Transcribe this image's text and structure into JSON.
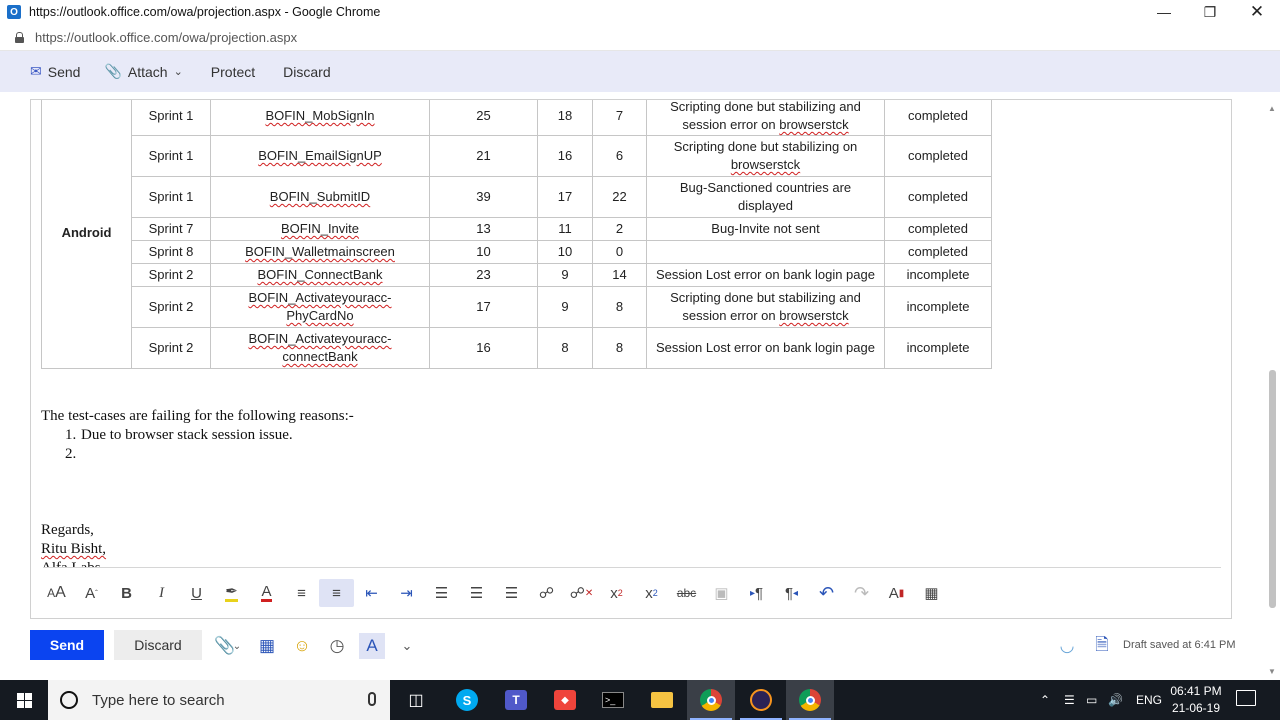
{
  "window": {
    "title": "https://outlook.office.com/owa/projection.aspx - Google Chrome",
    "icon": "outlook-icon",
    "controls": [
      "minimize-icon",
      "restore-icon",
      "close-icon"
    ]
  },
  "address": {
    "url": "https://outlook.office.com/owa/projection.aspx"
  },
  "command_bar": {
    "send_label": "Send",
    "attach_label": "Attach",
    "protect_label": "Protect",
    "discard_label": "Discard"
  },
  "table": {
    "group_label": "Android",
    "rows": [
      {
        "sprint": "Sprint 1",
        "name": "BOFIN_MobSignIn",
        "total": "25",
        "pass": "18",
        "fail": "7",
        "remarks": [
          "Scripting done but stabilizing and",
          "session error on ",
          "browserstck"
        ],
        "status": "completed"
      },
      {
        "sprint": "Sprint 1",
        "name": "BOFIN_EmailSignUP",
        "total": "21",
        "pass": "16",
        "fail": "6",
        "remarks": [
          "Scripting done but stabilizing on",
          "",
          "browserstck"
        ],
        "status": "completed"
      },
      {
        "sprint": "Sprint 1",
        "name": "BOFIN_SubmitID",
        "total": "39",
        "pass": "17",
        "fail": "22",
        "remarks": [
          "Bug-Sanctioned countries are",
          "displayed",
          ""
        ],
        "status": "completed"
      },
      {
        "sprint": "Sprint 7",
        "name": "BOFIN_Invite",
        "total": "13",
        "pass": "11",
        "fail": "2",
        "remarks": [
          "Bug-Invite not sent",
          "",
          ""
        ],
        "status": "completed"
      },
      {
        "sprint": "Sprint 8",
        "name": "BOFIN_Walletmainscreen",
        "total": "10",
        "pass": "10",
        "fail": "0",
        "remarks": [
          "",
          "",
          ""
        ],
        "status": "completed"
      },
      {
        "sprint": "Sprint 2",
        "name": "BOFIN_ConnectBank",
        "total": "23",
        "pass": "9",
        "fail": "14",
        "remarks": [
          "Session Lost error on bank login page",
          "",
          ""
        ],
        "status": "incomplete"
      },
      {
        "sprint": "Sprint 2",
        "name": "BOFIN_Activateyouracc-PhyCardNo",
        "total": "17",
        "pass": "9",
        "fail": "8",
        "remarks": [
          "Scripting done but stabilizing and",
          "session error on ",
          "browserstck"
        ],
        "status": "incomplete"
      },
      {
        "sprint": "Sprint 2",
        "name": "BOFIN_Activateyouracc-connectBank",
        "total": "16",
        "pass": "8",
        "fail": "8",
        "remarks": [
          "Session Lost error on bank login page",
          "",
          ""
        ],
        "status": "incomplete"
      }
    ],
    "name_line2": "connectBank",
    "name_line1": "BOFIN_Activateyouracc-"
  },
  "message": {
    "intro": "The test-cases are failing for the following reasons:-",
    "reason_1": "Due to browser stack session issue.",
    "reason_1_marker": "1.",
    "reason_2_marker": "2.",
    "closing": "Regards,",
    "signer": "Ritu Bisht,",
    "company": "Alfa Labs"
  },
  "format_toolbar": [
    "font-size-icon",
    "grow-font-icon",
    "bold-icon",
    "italic-icon",
    "underline-icon",
    "highlight-icon",
    "font-color-icon",
    "bullets-icon",
    "numbering-icon",
    "decrease-indent-icon",
    "increase-indent-icon",
    "align-left-icon",
    "align-center-icon",
    "align-right-icon",
    "insert-link-icon",
    "remove-link-icon",
    "superscript-icon",
    "subscript-icon",
    "strikethrough-icon",
    "insert-image-icon",
    "ltr-icon",
    "rtl-icon",
    "undo-icon",
    "redo-icon",
    "clear-format-icon",
    "table-icon"
  ],
  "bottom_bar": {
    "send_label": "Send",
    "discard_label": "Discard",
    "draft_status": "Draft saved at 6:41 PM"
  },
  "taskbar": {
    "search_placeholder": "Type here to search",
    "language": "ENG",
    "time": "06:41 PM",
    "date": "21-06-19"
  },
  "colors": {
    "send_button": "#0b44f0",
    "command_bar_bg": "#e8eaf8",
    "taskbar_bg": "#151a21"
  }
}
